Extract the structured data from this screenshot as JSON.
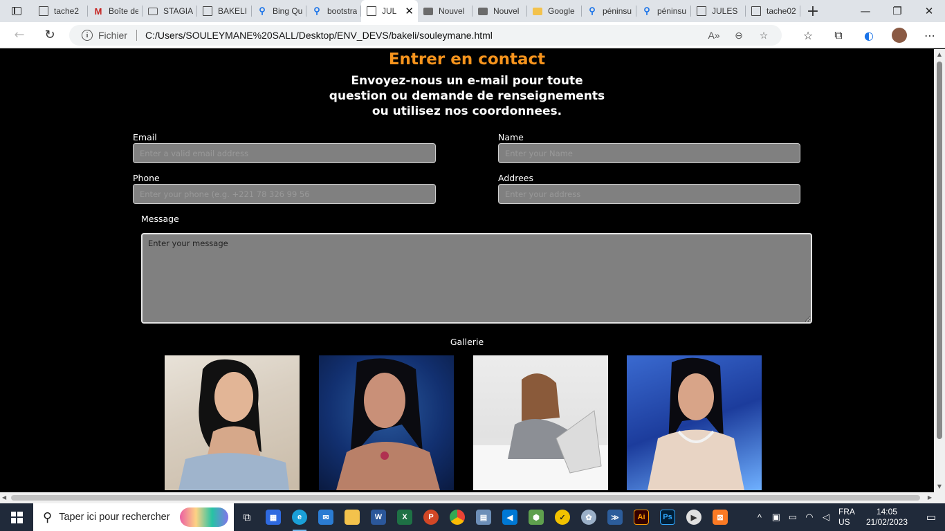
{
  "browser": {
    "tabs": [
      {
        "label": "tache2",
        "icon": "page-icon",
        "active": false
      },
      {
        "label": "Boîte de",
        "icon": "gmail-icon",
        "active": false
      },
      {
        "label": "STAGIA",
        "icon": "grid-icon",
        "active": false
      },
      {
        "label": "BAKELI",
        "icon": "page-icon",
        "active": false
      },
      {
        "label": "Bing Qu",
        "icon": "search-icon",
        "active": false
      },
      {
        "label": "bootstra",
        "icon": "search-icon",
        "active": false
      },
      {
        "label": "JUL",
        "icon": "page-icon",
        "active": true
      },
      {
        "label": "Nouvel",
        "icon": "tab-icon",
        "active": false
      },
      {
        "label": "Nouvel",
        "icon": "tab-icon",
        "active": false
      },
      {
        "label": "Google",
        "icon": "folder-icon",
        "active": false
      },
      {
        "label": "péninsu",
        "icon": "search-icon",
        "active": false
      },
      {
        "label": "péninsu",
        "icon": "search-icon",
        "active": false
      },
      {
        "label": "JULES",
        "icon": "page-icon",
        "active": false
      },
      {
        "label": "tache02",
        "icon": "page-icon",
        "active": false
      }
    ],
    "address": {
      "scheme_label": "Fichier",
      "url": "C:/Users/SOULEYMANE%20SALL/Desktop/ENV_DEVS/bakeli/souleymane.html"
    }
  },
  "page": {
    "heading": "Entrer en contact",
    "subheading": "Envoyez-nous un e-mail pour toute question ou demande de renseignements ou utilisez nos coordonnees.",
    "form": {
      "email_label": "Email",
      "email_placeholder": "Enter a valid email address",
      "name_label": "Name",
      "name_placeholder": "Enter your Name",
      "phone_label": "Phone",
      "phone_placeholder": "Enter your phone (e.g. +221 78 326 99 56",
      "address_label": "Addrees",
      "address_placeholder": "Enter your address",
      "message_label": "Message",
      "message_placeholder": "Enter your message"
    },
    "gallery": {
      "title": "Gallerie",
      "images": [
        "gallery-photo-1",
        "gallery-photo-2",
        "gallery-photo-3",
        "gallery-photo-4"
      ]
    }
  },
  "taskbar": {
    "search_placeholder": "Taper ici pour rechercher",
    "lang_top": "FRA",
    "lang_bottom": "US",
    "time": "14:05",
    "date": "21/02/2023"
  },
  "colors": {
    "heading": "#f7941d",
    "page_bg": "#000000",
    "input_bg": "#808080"
  }
}
